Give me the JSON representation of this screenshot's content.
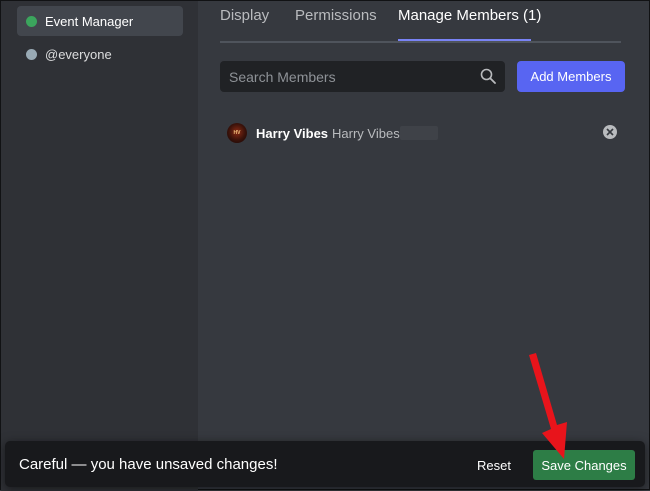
{
  "sidebar": {
    "roles": [
      {
        "label": "Event Manager",
        "color": "#3ba55d",
        "selected": true
      },
      {
        "label": "@everyone",
        "color": "#99aab5",
        "selected": false
      }
    ]
  },
  "tabs": [
    {
      "label": "Display",
      "active": false
    },
    {
      "label": "Permissions",
      "active": false
    },
    {
      "label": "Manage Members (1)",
      "active": true
    }
  ],
  "search": {
    "placeholder": "Search Members",
    "value": ""
  },
  "add_members_label": "Add Members",
  "members": [
    {
      "name": "Harry Vibes",
      "tag": "Harry Vibes",
      "avatar_text": "HARRY VIBES"
    }
  ],
  "notice": {
    "message": "Careful — you have unsaved changes!",
    "reset_label": "Reset",
    "save_label": "Save Changes"
  },
  "colors": {
    "accent": "#5865f2",
    "save": "#2d7d46",
    "annotation_arrow": "#e8141b"
  }
}
